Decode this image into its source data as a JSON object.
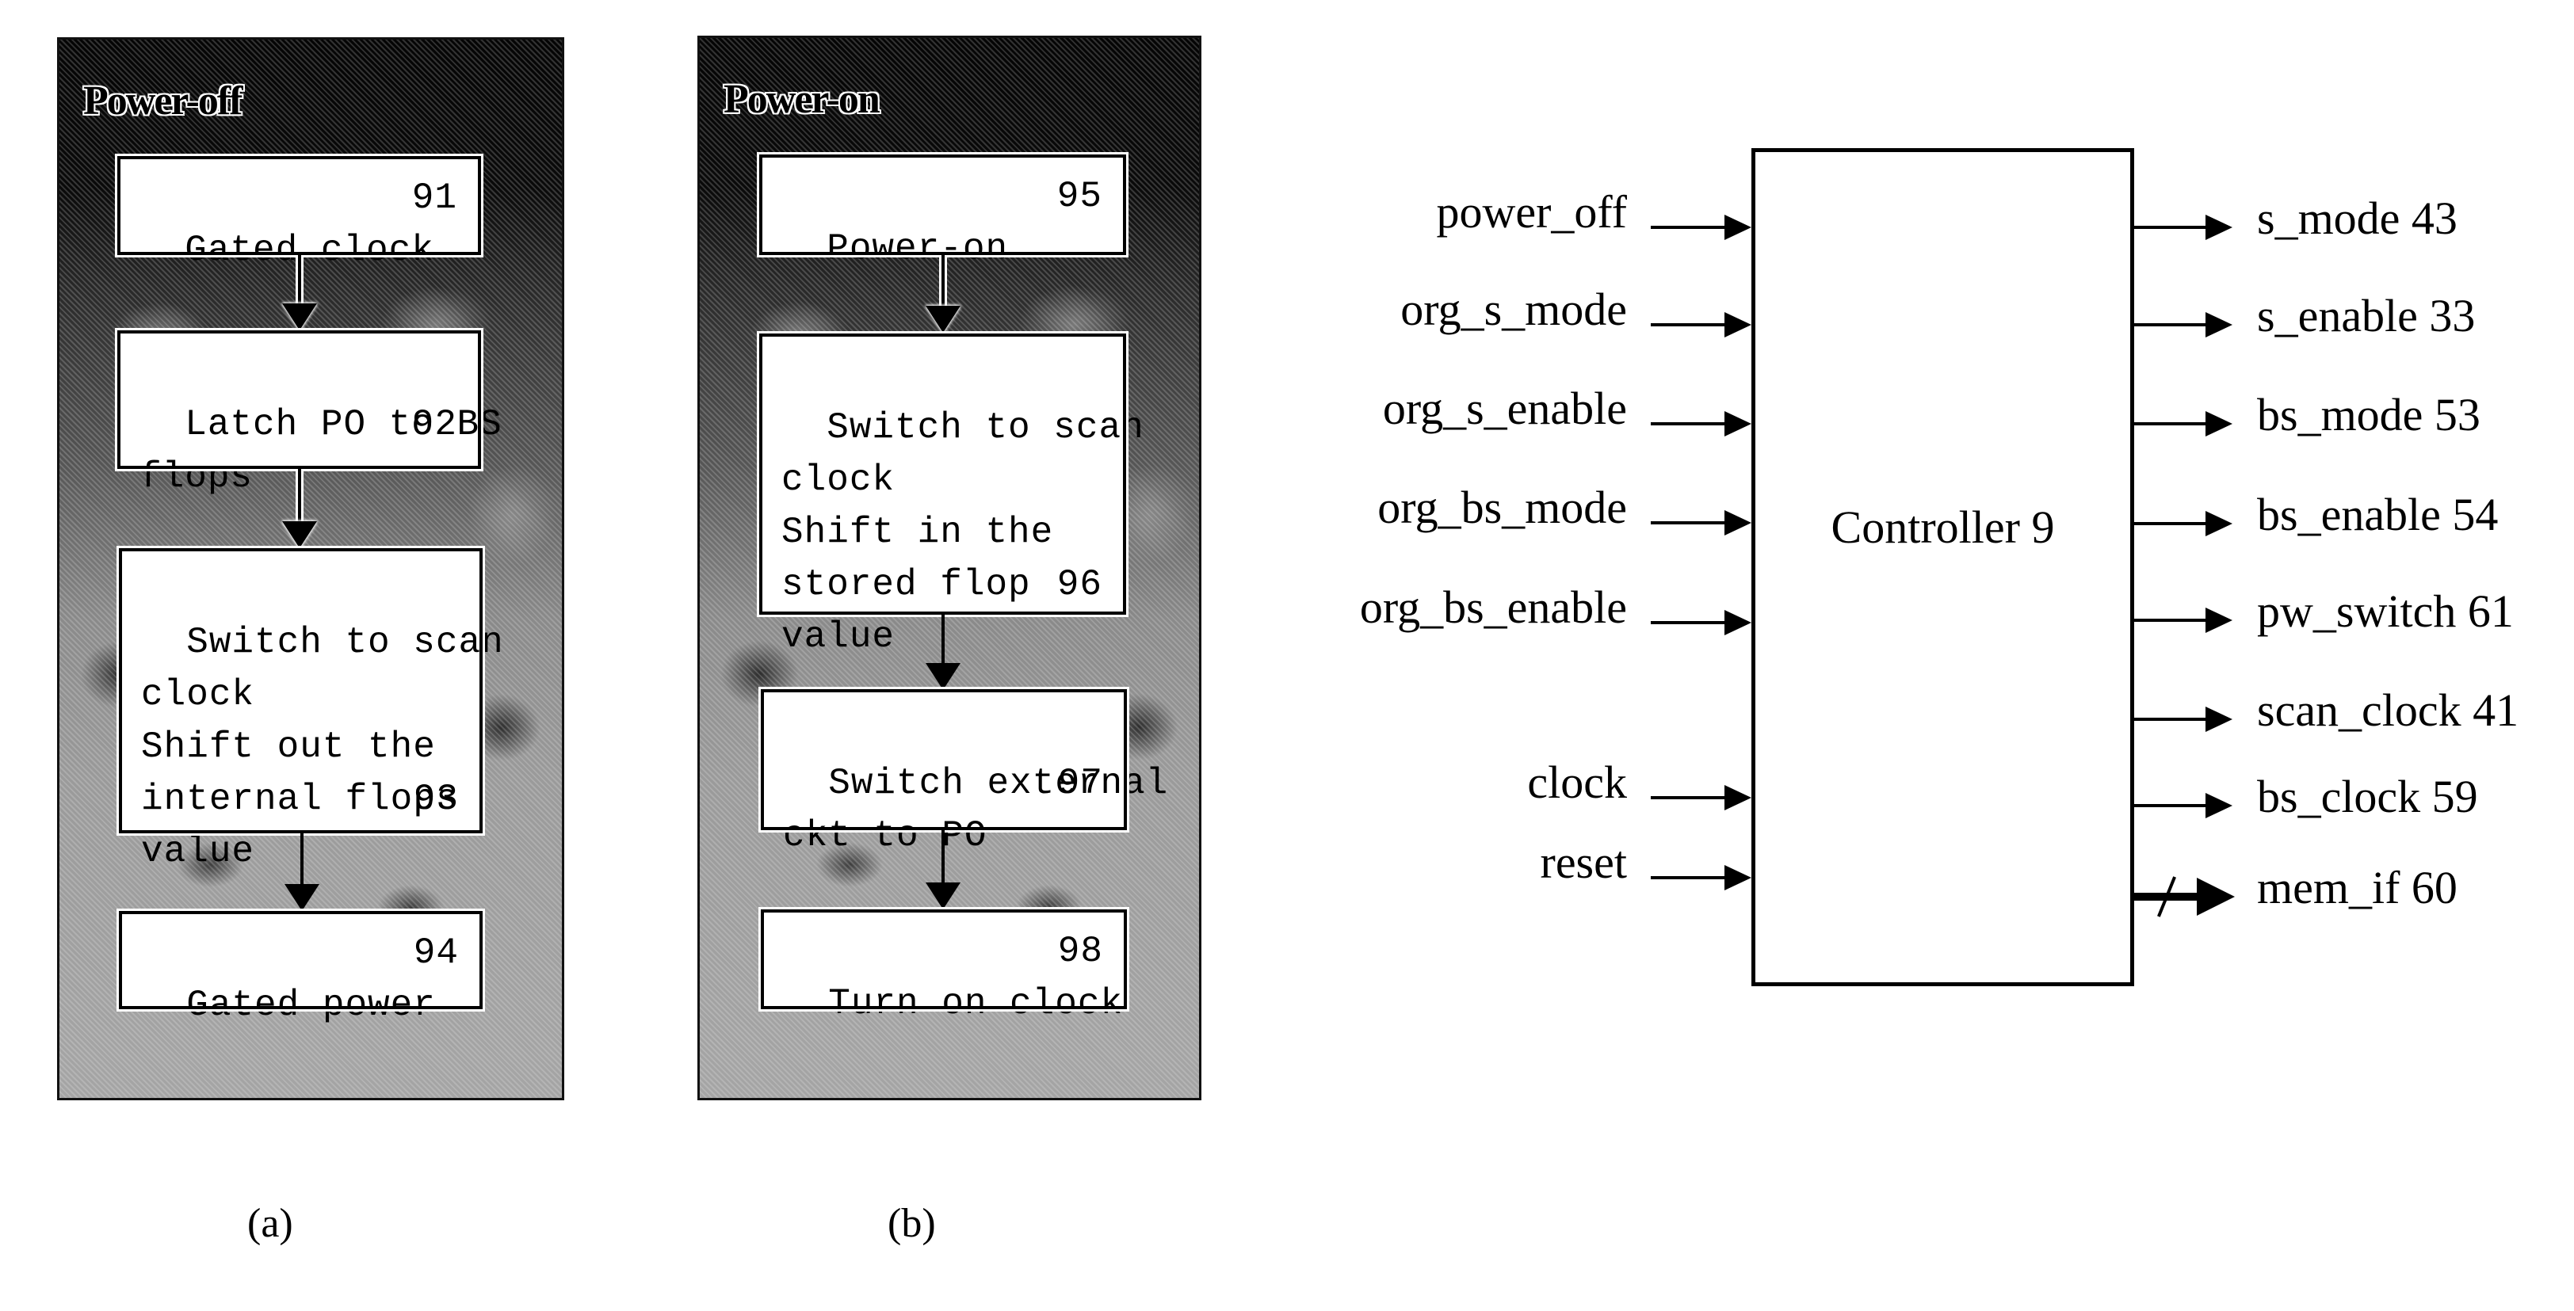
{
  "figure_a": {
    "title": "Power-off",
    "caption": "(a)",
    "steps": [
      {
        "text": "Gated clock",
        "number": "91"
      },
      {
        "text": "Latch PO to BS\nflops",
        "number": "92"
      },
      {
        "text": "Switch to scan\nclock\nShift out the\ninternal flops\nvalue",
        "number": "93"
      },
      {
        "text": "Gated power",
        "number": "94"
      }
    ]
  },
  "figure_b": {
    "title": "Power-on",
    "caption": "(b)",
    "steps": [
      {
        "text": "Power-on",
        "number": "95"
      },
      {
        "text": "Switch to scan\nclock\nShift in the\nstored flop\nvalue",
        "number": "96"
      },
      {
        "text": "Switch external\nckt to PO",
        "number": "97"
      },
      {
        "text": "Turn on clock",
        "number": "98"
      }
    ]
  },
  "controller": {
    "label": "Controller 9",
    "inputs": [
      "power_off",
      "org_s_mode",
      "org_s_enable",
      "org_bs_mode",
      "org_bs_enable",
      "clock",
      "reset"
    ],
    "outputs": [
      "s_mode 43",
      "s_enable 33",
      "bs_mode 53",
      "bs_enable 54",
      "pw_switch 61",
      "scan_clock 41",
      "bs_clock 59",
      "mem_if 60"
    ],
    "bus_outputs": [
      "mem_if 60"
    ]
  }
}
